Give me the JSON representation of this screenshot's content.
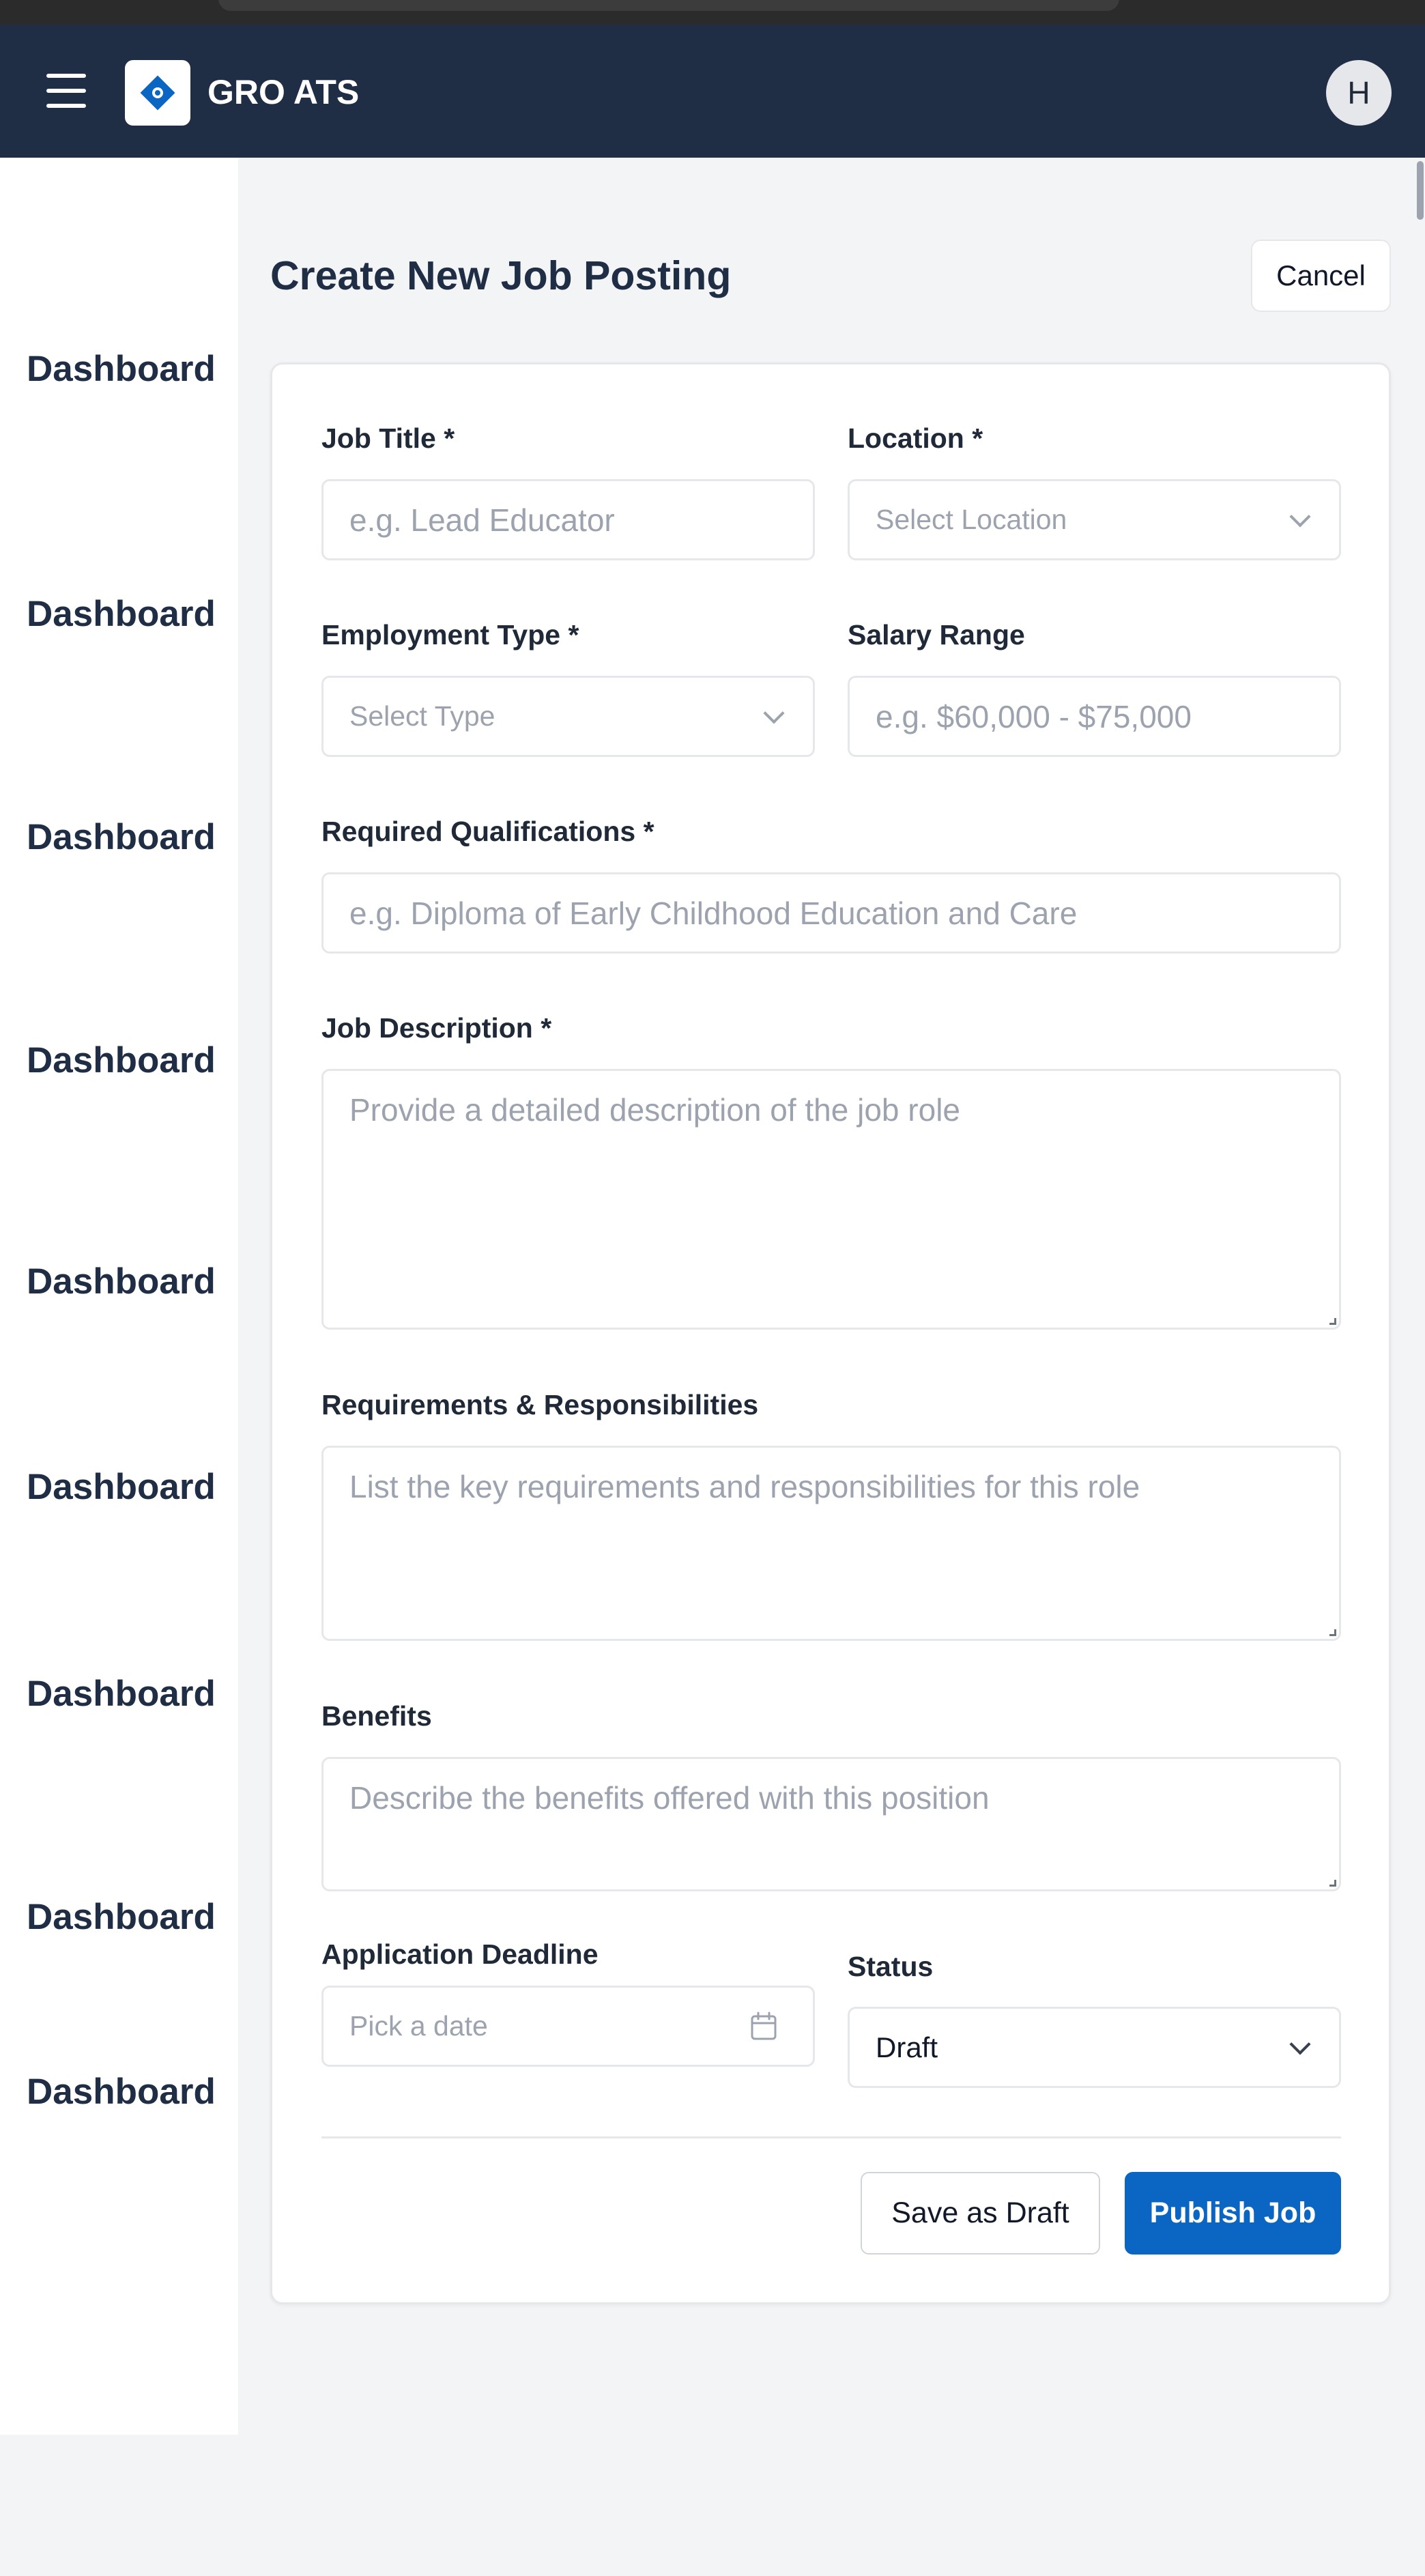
{
  "header": {
    "brand": "GRO ATS",
    "avatar_initial": "H"
  },
  "sidebar": {
    "items": [
      {
        "label": "Dashboard"
      },
      {
        "label": "Dashboard"
      },
      {
        "label": "Dashboard"
      },
      {
        "label": "Dashboard"
      },
      {
        "label": "Dashboard"
      },
      {
        "label": "Dashboard"
      },
      {
        "label": "Dashboard"
      },
      {
        "label": "Dashboard"
      },
      {
        "label": "Dashboard"
      }
    ]
  },
  "page": {
    "title": "Create New Job Posting",
    "cancel_label": "Cancel"
  },
  "form": {
    "job_title": {
      "label": "Job Title *",
      "placeholder": "e.g. Lead Educator"
    },
    "location": {
      "label": "Location *",
      "placeholder": "Select Location"
    },
    "employment_type": {
      "label": "Employment Type *",
      "placeholder": "Select Type"
    },
    "salary_range": {
      "label": "Salary Range",
      "placeholder": "e.g. $60,000 - $75,000"
    },
    "qualifications": {
      "label": "Required Qualifications *",
      "placeholder": "e.g. Diploma of Early Childhood Education and Care"
    },
    "description": {
      "label": "Job Description *",
      "placeholder": "Provide a detailed description of the job role"
    },
    "requirements": {
      "label": "Requirements & Responsibilities",
      "placeholder": "List the key requirements and responsibilities for this role"
    },
    "benefits": {
      "label": "Benefits",
      "placeholder": "Describe the benefits offered with this position"
    },
    "deadline": {
      "label": "Application Deadline",
      "placeholder": "Pick a date"
    },
    "status": {
      "label": "Status",
      "value": "Draft"
    }
  },
  "actions": {
    "save_draft_label": "Save as Draft",
    "publish_label": "Publish Job"
  },
  "colors": {
    "header_bg": "#1f2d45",
    "primary": "#0a66c2",
    "page_bg": "#f3f4f6"
  }
}
